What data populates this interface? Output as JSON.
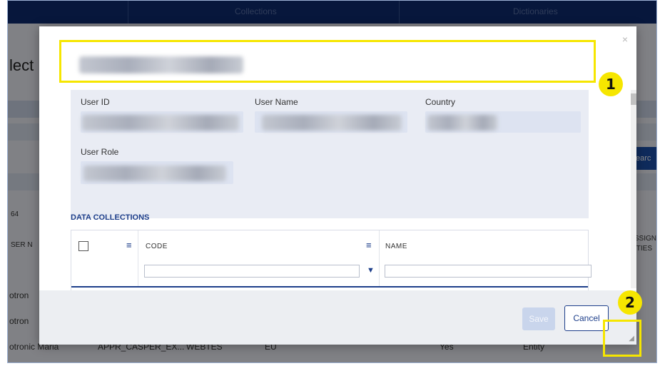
{
  "topnav": {
    "item_1": "Collections",
    "item_2": "Dictionaries"
  },
  "background": {
    "title_fragment": "lect",
    "count": "64",
    "col_left": "SER N",
    "col_right_1": "SSIGN",
    "col_right_2": "TIES",
    "search_label": "Searc",
    "rows": [
      {
        "a": "otron",
        "b": "",
        "c": "",
        "d": "",
        "e": "",
        "f": ""
      },
      {
        "a": "otron",
        "b": "",
        "c": "",
        "d": "",
        "e": "",
        "f": ""
      },
      {
        "a": "otronic Maria",
        "b": "APPR_CASPER_EX...",
        "c": "WEBTES",
        "d": "EU",
        "e": "Yes",
        "f": "Entity"
      }
    ]
  },
  "modal": {
    "close_glyph": "×",
    "fields": {
      "user_id_label": "User ID",
      "user_name_label": "User Name",
      "country_label": "Country",
      "user_role_label": "User Role"
    },
    "section_title": "DATA COLLECTIONS",
    "grid": {
      "columns": [
        {
          "title": "CODE"
        },
        {
          "title": "NAME"
        }
      ]
    },
    "footer": {
      "save_label": "Save",
      "cancel_label": "Cancel"
    }
  },
  "annotations": {
    "badge_1": "1",
    "badge_2": "2"
  },
  "colors": {
    "highlight": "#f6e600",
    "nav": "#0d2a6e",
    "accent": "#1d3e8a"
  }
}
